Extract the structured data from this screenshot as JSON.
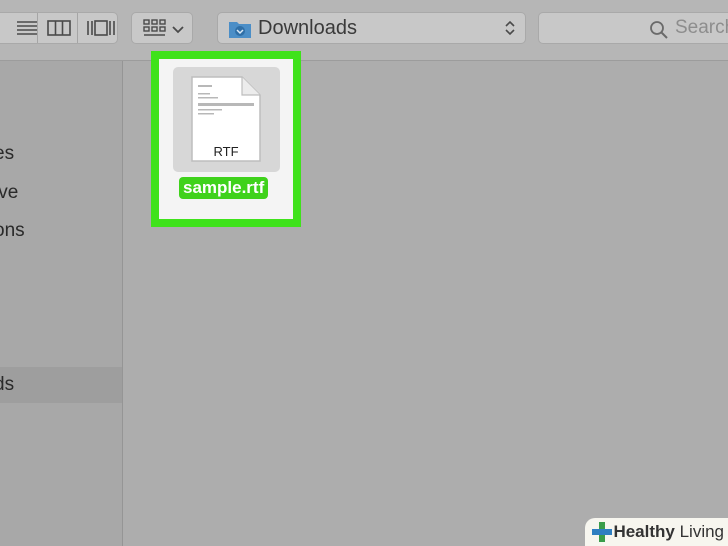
{
  "toolbar": {
    "view_buttons": [
      "list-view-icon",
      "column-view-icon",
      "cover-flow-icon"
    ],
    "arrange_icon": "grid-arrange-icon",
    "path": {
      "label": "Downloads",
      "icon": "downloads-folder-icon"
    },
    "search": {
      "placeholder": "Search"
    }
  },
  "sidebar": {
    "items": [
      {
        "label": "es"
      },
      {
        "label": "ive"
      },
      {
        "label": "ons"
      },
      {
        "label": "ds",
        "selected": true
      }
    ]
  },
  "content": {
    "file": {
      "name": "sample.rtf",
      "type_label": "RTF",
      "selected": true
    }
  },
  "watermark": {
    "brand_bold": "Healthy",
    "brand_rest": " Living"
  },
  "colors": {
    "highlight": "#3fe21b",
    "selection": "#3fd21b"
  }
}
